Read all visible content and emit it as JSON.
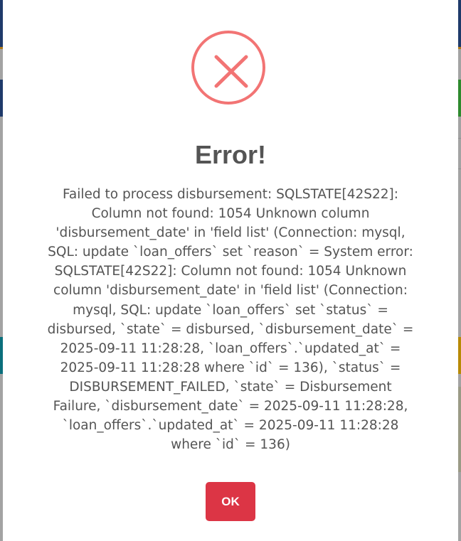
{
  "dialog": {
    "title": "Error!",
    "icon": "error-x-icon",
    "icon_color": "#f27474",
    "message": "Failed to process disbursement: SQLSTATE[42S22]: Column not found: 1054 Unknown column 'disbursement_date' in 'field list' (Connection: mysql, SQL: update `loan_offers` set `reason` = System error: SQLSTATE[42S22]: Column not found: 1054 Unknown column 'disbursement_date' in 'field list' (Connection: mysql, SQL: update `loan_offers` set `status` = disbursed, `state` = disbursed, `disbursement_date` = 2025-09-11 11:28:28, `loan_offers`.`updated_at` = 2025-09-11 11:28:28 where `id` = 136), `status` = DISBURSEMENT_FAILED, `state` = Disbursement Failure, `disbursement_date` = 2025-09-11 11:28:28, `loan_offers`.`updated_at` = 2025-09-11 11:28:28 where `id` = 136)",
    "message_lines": [
      "Failed to process disbursement: SQLSTATE[42S22]:",
      "Column not found: 1054 Unknown column",
      "'disbursement_date' in 'field list' (Connection: mysql,",
      "SQL: update `loan_offers` set `reason` = System error:",
      "SQLSTATE[42S22]: Column not found: 1054 Unknown",
      "column 'disbursement_date' in 'field list' (Connection:",
      "mysql, SQL: update `loan_offers` set `status` =",
      "disbursed, `state` = disbursed, `disbursement_date` =",
      "2025-09-11 11:28:28, `loan_offers`.`updated_at` =",
      "2025-09-11 11:28:28 where `id` = 136), `status` =",
      "DISBURSEMENT_FAILED, `state` = Disbursement",
      "Failure, `disbursement_date` = 2025-09-11 11:28:28,",
      "`loan_offers`.`updated_at` = 2025-09-11 11:28:28",
      "where `id` = 136)"
    ],
    "confirm_label": "OK",
    "confirm_color": "#dc3545"
  }
}
